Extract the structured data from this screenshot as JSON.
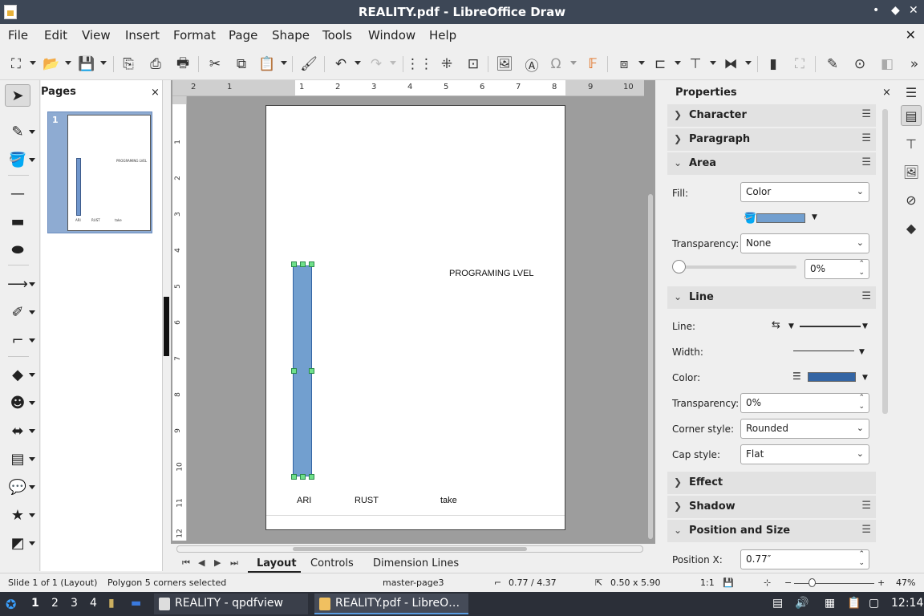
{
  "window": {
    "title": "REALITY.pdf - LibreOffice Draw",
    "min": "•",
    "max": "◆",
    "close": "✕"
  },
  "menu": {
    "items": [
      "File",
      "Edit",
      "View",
      "Insert",
      "Format",
      "Page",
      "Shape",
      "Tools",
      "Window",
      "Help"
    ],
    "close_doc": "✕"
  },
  "pages_pane": {
    "title": "Pages",
    "close": "×",
    "page_number": "1",
    "thumb_texts": {
      "title": "PROGRAMING LVEL",
      "a": "ARI",
      "b": "RUST",
      "c": "take"
    }
  },
  "ruler": {
    "h": [
      "2",
      "1",
      "1",
      "2",
      "3",
      "4",
      "5",
      "6",
      "7",
      "8",
      "9",
      "10"
    ],
    "v": [
      "1",
      "2",
      "3",
      "4",
      "5",
      "6",
      "7",
      "8",
      "9",
      "10",
      "11",
      "12"
    ]
  },
  "document": {
    "heading": "PROGRAMING LVEL",
    "labels": [
      "ARI",
      "RUST",
      "take"
    ]
  },
  "tabs": {
    "layout": "Layout",
    "controls": "Controls",
    "dimension_lines": "Dimension Lines"
  },
  "sidebar": {
    "title": "Properties",
    "close": "×",
    "sections": {
      "character": "Character",
      "paragraph": "Paragraph",
      "area": "Area",
      "line": "Line",
      "effect": "Effect",
      "shadow": "Shadow",
      "position_size": "Position and Size"
    },
    "area": {
      "fill_label": "Fill:",
      "fill_value": "Color",
      "fill_color": "#729fcf",
      "transparency_label": "Transparency:",
      "transparency_value": "None",
      "transparency_percent": "0%",
      "transparency_slider": 0
    },
    "line": {
      "line_label": "Line:",
      "width_label": "Width:",
      "color_label": "Color:",
      "color_value": "#3465a4",
      "transparency_label": "Transparency:",
      "transparency_value": "0%",
      "corner_label": "Corner style:",
      "corner_value": "Rounded",
      "cap_label": "Cap style:",
      "cap_value": "Flat"
    },
    "position": {
      "x_label": "Position X:",
      "x_value": "0.77″"
    }
  },
  "status": {
    "slide": "Slide 1 of 1 (Layout)",
    "selection": "Polygon 5 corners selected",
    "master": "master-page3",
    "position": "0.77 / 4.37",
    "size": "0.50 x 5.90",
    "scale": "1:1",
    "zoom": "47%",
    "zoom_level": 0.47
  },
  "taskbar": {
    "workspaces": [
      "1",
      "2",
      "3",
      "4"
    ],
    "tasks": [
      "REALITY - qpdfview",
      "REALITY.pdf - LibreO…"
    ],
    "clock": "12:14"
  },
  "colors": {
    "accent": "#3465a4",
    "shape_fill": "#729fcf",
    "handle": "#6fe08a"
  }
}
